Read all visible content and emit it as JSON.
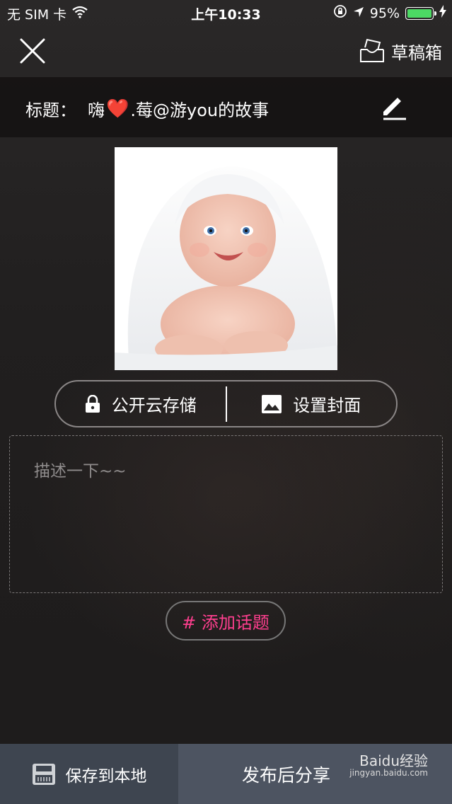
{
  "status_bar": {
    "carrier": "无 SIM 卡",
    "time": "上午10:33",
    "battery": "95%",
    "battery_level": 0.95
  },
  "nav": {
    "drafts_label": "草稿箱"
  },
  "title_row": {
    "label": "标题：",
    "prefix": "嗨",
    "heart": "❤️",
    "suffix": ".莓@游you的故事"
  },
  "actions": {
    "public_storage_label": "公开云存储",
    "set_cover_label": "设置封面"
  },
  "description": {
    "placeholder": "描述一下~~"
  },
  "topic": {
    "label": "# 添加话题"
  },
  "bottom": {
    "save_local_label": "保存到本地",
    "publish_share_label": "发布后分享"
  },
  "watermark": {
    "main": "Baidu经验",
    "sub": "jingyan.baidu.com"
  },
  "colors": {
    "topic_accent": "#ff3f8f",
    "battery_green": "#4cd964",
    "save_bg": "#3e4550",
    "publish_bg": "#4d5461"
  }
}
